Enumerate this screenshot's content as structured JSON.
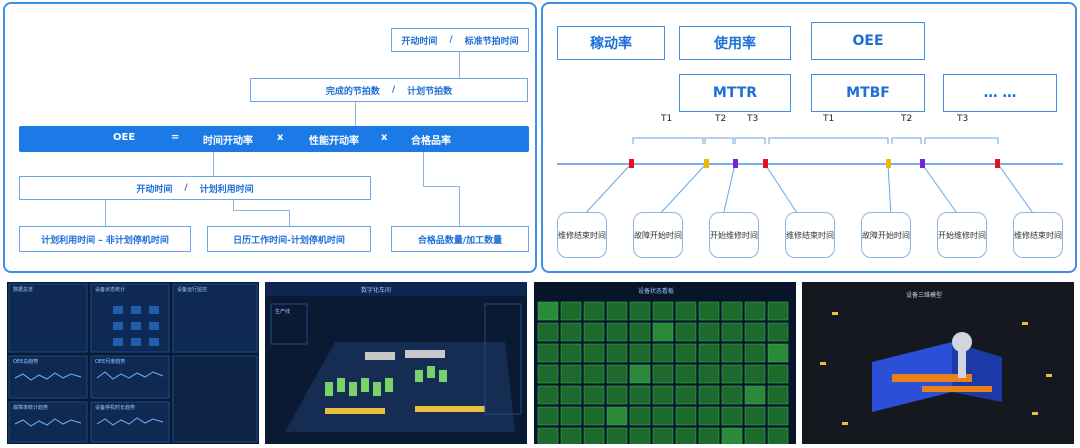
{
  "oee_formula": {
    "top_box": {
      "left": "开动时间",
      "sep": "/",
      "right": "标准节拍时间"
    },
    "second_box": {
      "left": "完成的节拍数",
      "sep": "/",
      "right": "计划节拍数"
    },
    "main_bar": {
      "t1": "OEE",
      "t2": "=",
      "t3": "时间开动率",
      "t4": "x",
      "t5": "性能开动率",
      "t6": "x",
      "t7": "合格品率"
    },
    "mid_box": {
      "left": "开动时间",
      "sep": "/",
      "right": "计划利用时间"
    },
    "bottom_boxes": [
      "计划利用时间 – 非计划停机时间",
      "日历工作时间-计划停机时间",
      "合格品数量/加工数量"
    ]
  },
  "timeline": {
    "kpis_row1": [
      "稼动率",
      "使用率",
      "OEE"
    ],
    "kpis_row2": [
      "MTTR",
      "MTBF",
      "… …"
    ],
    "interval_labels": [
      "T1",
      "T2",
      "T3",
      "T1",
      "T2",
      "T3"
    ],
    "events": [
      "维修结束时间",
      "故障开始时间",
      "开始维修时间",
      "维修结束时间",
      "故障开始时间",
      "开始维修时间",
      "维修结束时间"
    ],
    "colors": {
      "repair_end": "#e8101a",
      "fault_start": "#f2b705",
      "repair_start": "#7a22d8"
    }
  },
  "dashboard": {
    "s1": {
      "title": "数据总览",
      "t2": "设备状态统计",
      "t3": "设备运行监控",
      "c1": "OEE总趋势",
      "c2": "OEE月度趋势",
      "c3": "故障率统计趋势",
      "c4": "设备停机时长趋势"
    },
    "s2": {
      "title": "数字化车间",
      "left": "生产线"
    },
    "s3": {
      "title": "设备状态看板"
    },
    "s4": {
      "title": "设备三维模型"
    }
  }
}
